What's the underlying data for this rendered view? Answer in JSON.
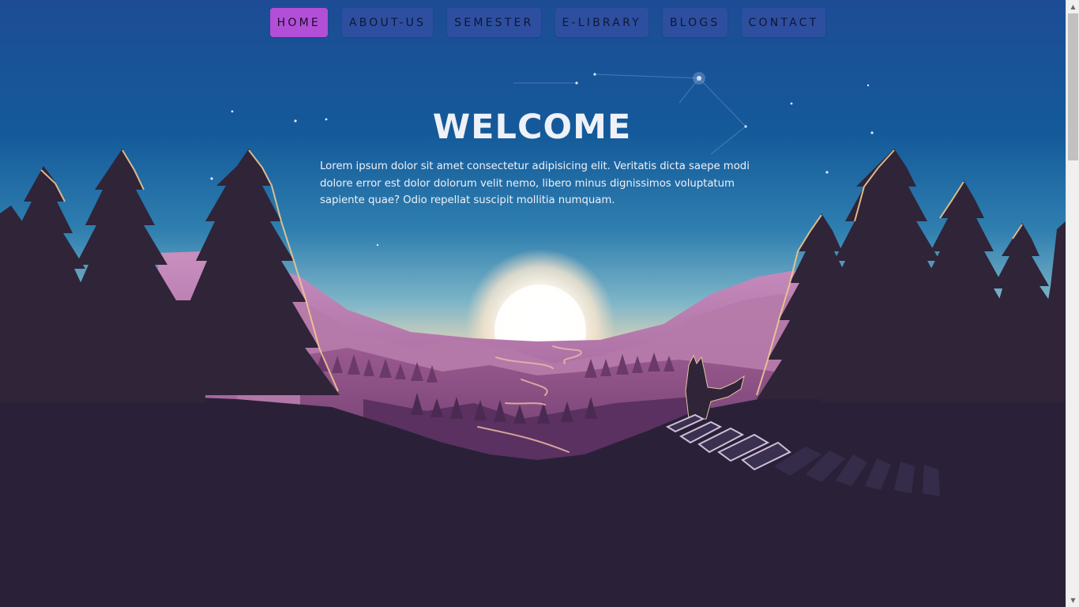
{
  "nav": {
    "items": [
      {
        "label": "HOME",
        "active": true
      },
      {
        "label": "ABOUT-US",
        "active": false
      },
      {
        "label": "SEMESTER",
        "active": false
      },
      {
        "label": "E-LIBRARY",
        "active": false
      },
      {
        "label": "BLOGS",
        "active": false
      },
      {
        "label": "CONTACT",
        "active": false
      }
    ]
  },
  "hero": {
    "title": "WELCOME",
    "body": "Lorem ipsum dolor sit amet consectetur adipisicing elit. Veritatis dicta saepe modi dolore error est dolor dolorum velit nemo, libero minus dignissimos voluptatum sapiente quae? Odio repellat suscipit mollitia numquam."
  },
  "colors": {
    "nav_button": "#2e4fa0",
    "nav_active": "#b24fd6",
    "ground": "#2a2139"
  }
}
